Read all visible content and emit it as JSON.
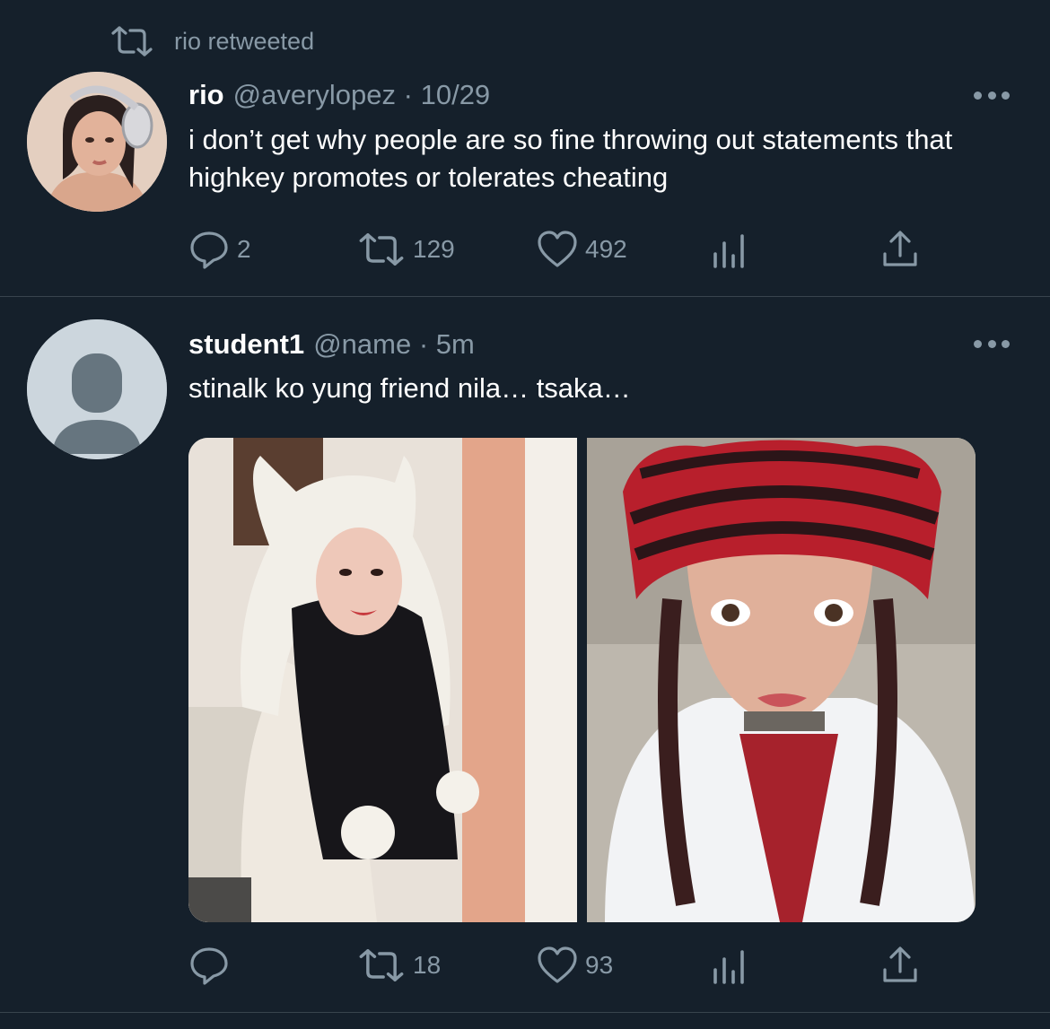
{
  "retweet_banner": {
    "icon": "retweet-icon",
    "text": "rio retweeted"
  },
  "tweets": [
    {
      "name": "rio",
      "handle": "@averylopez",
      "separator": "·",
      "time": "10/29",
      "text": "i don’t get why people are so fine throwing out statements that highkey promotes or tolerates cheating",
      "actions": {
        "reply": "2",
        "retweet": "129",
        "like": "492"
      }
    },
    {
      "name": "student1",
      "handle": "@name",
      "separator": "·",
      "time": "5m",
      "text": "stinalk ko yung friend nila… tsaka…",
      "actions": {
        "reply": "",
        "retweet": "18",
        "like": "93"
      }
    }
  ],
  "colors": {
    "background": "#15202b",
    "secondary_text": "#8899a6",
    "divider": "#38444d"
  }
}
